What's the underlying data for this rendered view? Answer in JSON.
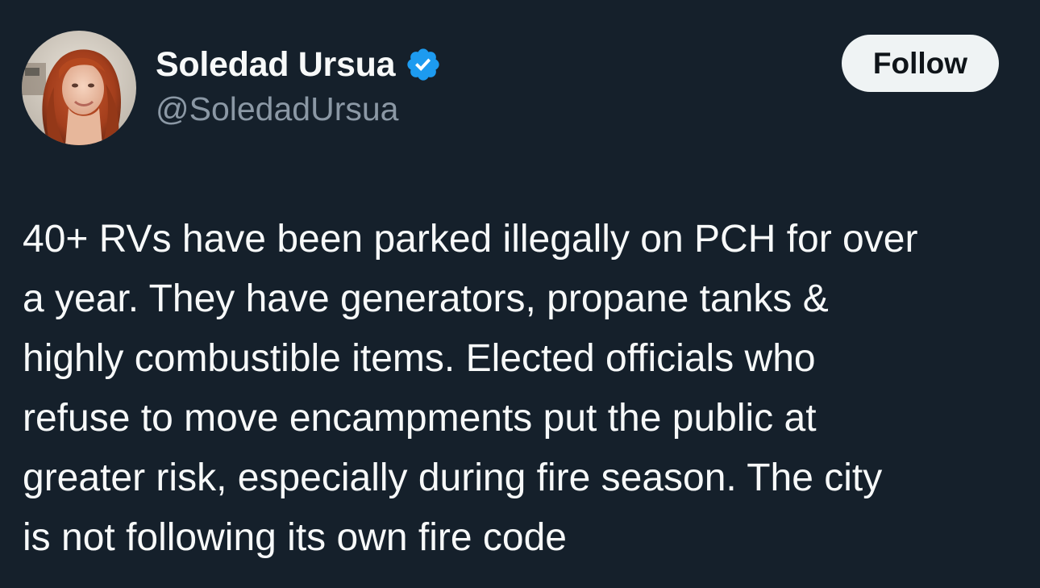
{
  "author": {
    "display_name": "Soledad Ursua",
    "handle": "@SoledadUrsua",
    "verified": true,
    "verified_icon": "verified-badge-icon",
    "verified_color": "#1d9bf0"
  },
  "actions": {
    "follow_label": "Follow"
  },
  "tweet": {
    "lines": [
      "40+ RVs have been parked illegally on PCH for over",
      "a year. They have generators, propane tanks &",
      "highly combustible items. Elected officials who",
      "refuse to move encampments put the public at",
      "greater risk, especially during fire season. The city",
      "is not following its own fire code"
    ]
  },
  "theme": {
    "background": "#15202b",
    "text_primary": "#f7f9f9",
    "text_secondary": "#8b98a5",
    "button_bg": "#eff3f4",
    "button_text": "#0f1419"
  }
}
